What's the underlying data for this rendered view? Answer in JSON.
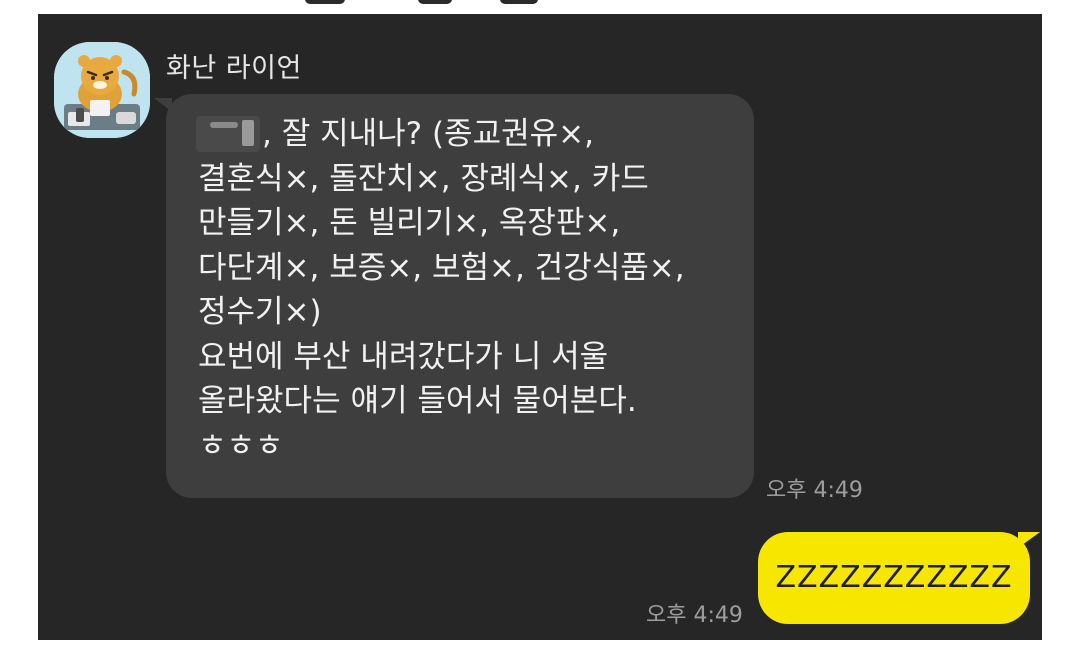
{
  "conversation": {
    "incoming": {
      "sender_name": "화난 라이언",
      "avatar_icon": "angry-lion-character-icon",
      "message_text": ", 잘 지내나? (종교권유×,\n결혼식×, 돌잔치×, 장례식×, 카드\n만들기×, 돈 빌리기×, 옥장판×,\n다단계×, 보증×, 보험×, 건강식품×,\n정수기×)\n요번에 부산 내려갔다가 니 서울\n올라왔다는 얘기 들어서 물어본다.\nㅎㅎㅎ",
      "time": "오후 4:49"
    },
    "outgoing": {
      "message_text": "ZZZZZZZZZZZ",
      "time": "오후 4:49"
    }
  },
  "colors": {
    "chat_background": "#262626",
    "incoming_bubble": "#3e3e3e",
    "outgoing_bubble": "#f7e600",
    "timestamp": "#9d9d9d"
  }
}
